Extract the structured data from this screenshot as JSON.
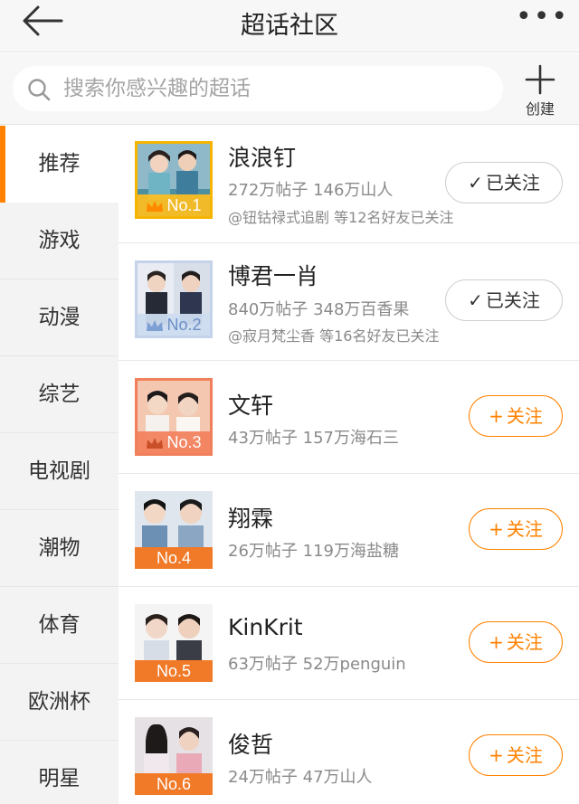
{
  "header": {
    "title": "超话社区",
    "back_icon": "arrow-left-icon",
    "more_icon": "more-dots-icon",
    "more_label": "•••"
  },
  "search": {
    "placeholder": "搜索你感兴趣的超话",
    "value": "",
    "icon": "search-icon"
  },
  "create": {
    "label": "创建",
    "icon": "plus-icon"
  },
  "accent_color": "#ff8200",
  "categories": [
    {
      "label": "推荐",
      "active": true
    },
    {
      "label": "游戏"
    },
    {
      "label": "动漫"
    },
    {
      "label": "综艺"
    },
    {
      "label": "电视剧"
    },
    {
      "label": "潮物"
    },
    {
      "label": "体育"
    },
    {
      "label": "欧洲杯"
    },
    {
      "label": "明星"
    }
  ],
  "topics": [
    {
      "rank": "No.1",
      "name": "浪浪钉",
      "stats": "272万帖子 146万山人",
      "friends": "@钮钴禄式追剧 等12名好友已关注",
      "button": "已关注",
      "button_symbol": "✓",
      "followed": true
    },
    {
      "rank": "No.2",
      "name": "博君一肖",
      "stats": "840万帖子 348万百香果",
      "friends": "@寂月梵尘香 等16名好友已关注",
      "button": "已关注",
      "button_symbol": "✓",
      "followed": true
    },
    {
      "rank": "No.3",
      "name": "文轩",
      "stats": "43万帖子 157万海石三",
      "button": "关注",
      "button_symbol": "+",
      "followed": false
    },
    {
      "rank": "No.4",
      "name": "翔霖",
      "stats": "26万帖子 119万海盐糖",
      "button": "关注",
      "button_symbol": "+",
      "followed": false
    },
    {
      "rank": "No.5",
      "name": "KinKrit",
      "stats": "63万帖子 52万penguin",
      "button": "关注",
      "button_symbol": "+",
      "followed": false
    },
    {
      "rank": "No.6",
      "name": "俊哲",
      "stats": "24万帖子 47万山人",
      "button": "关注",
      "button_symbol": "+",
      "followed": false
    }
  ]
}
